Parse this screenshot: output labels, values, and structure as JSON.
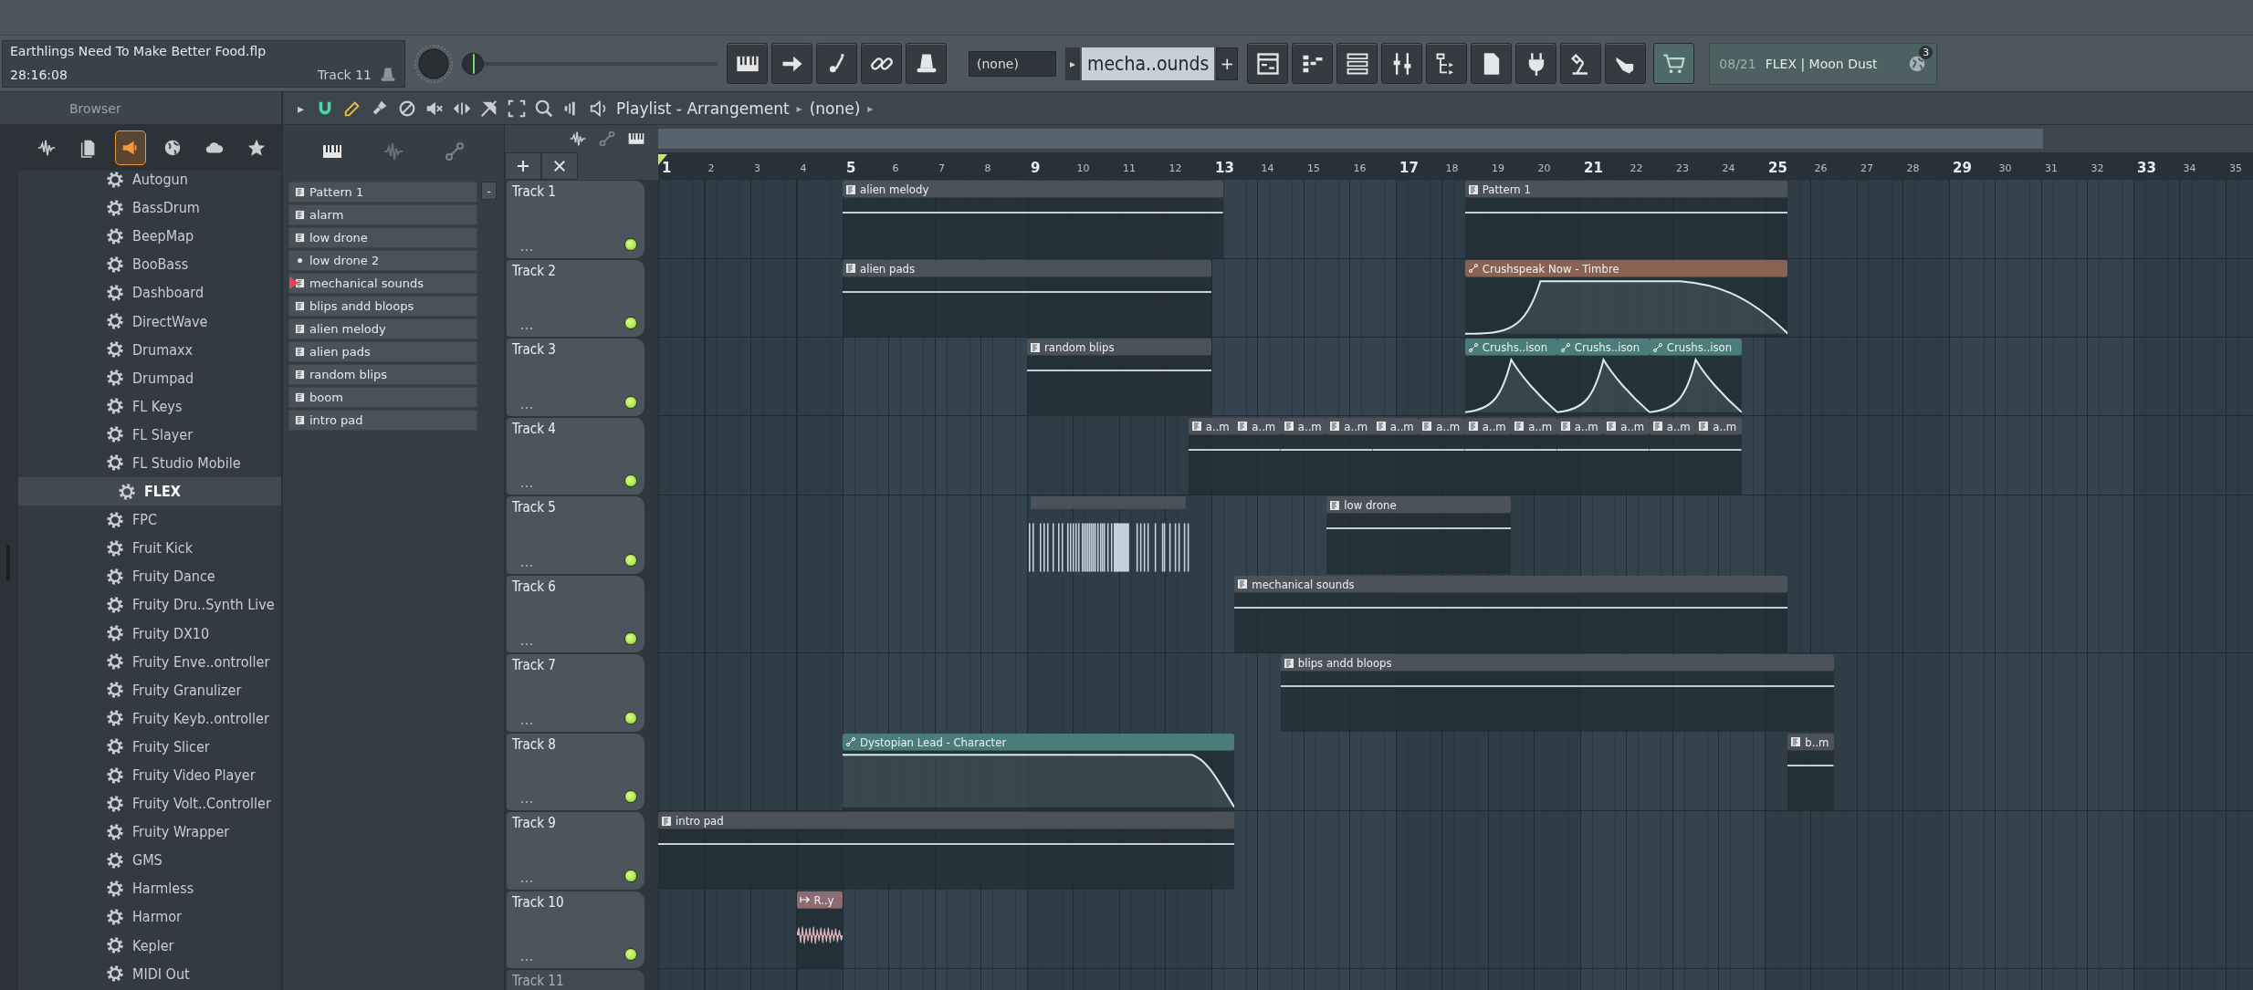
{
  "toolbar": {
    "song_title": "Earthlings Need To Make Better Food.flp",
    "song_time": "28:16:08",
    "hint_target": "Track 11",
    "master_pitch": {
      "level": 0
    },
    "pattern_selector": "(none)",
    "pattern_menu_arrow": "▸",
    "pattern_name": "mecha..ounds",
    "add_pattern": "+",
    "hint_counter": "08/21",
    "hint_text": "FLEX | Moon Dust",
    "notification_count": "3"
  },
  "browser": {
    "title": "Browser",
    "tabs": [
      {
        "kind": "audio",
        "selected": false
      },
      {
        "kind": "files",
        "selected": false
      },
      {
        "kind": "plugins",
        "selected": true
      },
      {
        "kind": "web",
        "selected": false
      },
      {
        "kind": "cloud",
        "selected": false
      },
      {
        "kind": "favorites",
        "selected": false
      }
    ],
    "items": [
      {
        "label": "Autogun",
        "selected": false
      },
      {
        "label": "BassDrum",
        "selected": false
      },
      {
        "label": "BeepMap",
        "selected": false
      },
      {
        "label": "BooBass",
        "selected": false
      },
      {
        "label": "Dashboard",
        "selected": false
      },
      {
        "label": "DirectWave",
        "selected": false
      },
      {
        "label": "Drumaxx",
        "selected": false
      },
      {
        "label": "Drumpad",
        "selected": false
      },
      {
        "label": "FL Keys",
        "selected": false
      },
      {
        "label": "FL Slayer",
        "selected": false
      },
      {
        "label": "FL Studio Mobile",
        "selected": false
      },
      {
        "label": "FLEX",
        "selected": true
      },
      {
        "label": "FPC",
        "selected": false
      },
      {
        "label": "Fruit Kick",
        "selected": false
      },
      {
        "label": "Fruity Dance",
        "selected": false
      },
      {
        "label": "Fruity Dru..Synth Live",
        "selected": false
      },
      {
        "label": "Fruity DX10",
        "selected": false
      },
      {
        "label": "Fruity Enve..ontroller",
        "selected": false
      },
      {
        "label": "Fruity Granulizer",
        "selected": false
      },
      {
        "label": "Fruity Keyb..ontroller",
        "selected": false
      },
      {
        "label": "Fruity Slicer",
        "selected": false
      },
      {
        "label": "Fruity Video Player",
        "selected": false
      },
      {
        "label": "Fruity Volt..Controller",
        "selected": false
      },
      {
        "label": "Fruity Wrapper",
        "selected": false
      },
      {
        "label": "GMS",
        "selected": false
      },
      {
        "label": "Harmless",
        "selected": false
      },
      {
        "label": "Harmor",
        "selected": false
      },
      {
        "label": "Kepler",
        "selected": false
      },
      {
        "label": "MIDI Out",
        "selected": false
      }
    ]
  },
  "playlist": {
    "menu_arrow": "▸",
    "title": "Playlist - Arrangement",
    "breadcrumb": [
      {
        "separator": "▸"
      },
      {
        "label": "(none)",
        "separator": "▸"
      }
    ],
    "patterns": [
      {
        "label": "Pattern 1",
        "kind": "pattern",
        "selected": false
      },
      {
        "label": "alarm",
        "kind": "pattern",
        "selected": false
      },
      {
        "label": "low drone",
        "kind": "pattern",
        "selected": false
      },
      {
        "label": "low drone 2",
        "kind": "layer",
        "selected": false
      },
      {
        "label": "mechanical sounds",
        "kind": "pattern",
        "selected": true
      },
      {
        "label": "blips andd bloops",
        "kind": "pattern",
        "selected": false
      },
      {
        "label": "alien melody",
        "kind": "pattern",
        "selected": false
      },
      {
        "label": "alien pads",
        "kind": "pattern",
        "selected": false
      },
      {
        "label": "random blips",
        "kind": "pattern",
        "selected": false
      },
      {
        "label": "boom",
        "kind": "pattern",
        "selected": false
      },
      {
        "label": "intro pad",
        "kind": "pattern",
        "selected": false
      }
    ],
    "collapse_button": "-",
    "ruler": [
      "1",
      "2",
      "3",
      "4",
      "5",
      "6",
      "7",
      "8",
      "9",
      "10",
      "11",
      "12",
      "13",
      "14",
      "15",
      "16",
      "17",
      "18",
      "19",
      "20",
      "21",
      "22",
      "23",
      "24",
      "25",
      "26",
      "27",
      "28",
      "29",
      "30",
      "31",
      "32",
      "33",
      "34",
      "35"
    ],
    "tracks": [
      {
        "name": "Track 1",
        "dimmed": false,
        "clips": [
          {
            "label": "alien melody",
            "kind": "pattern",
            "color": "#4b5259"
          },
          {
            "label": "Pattern 1",
            "kind": "pattern",
            "color": "#4b5259"
          }
        ]
      },
      {
        "name": "Track 2",
        "dimmed": false,
        "clips": [
          {
            "label": "alien pads",
            "kind": "pattern",
            "color": "#4b5259"
          },
          {
            "label": "Crushspeak Now - Timbre",
            "kind": "ramp",
            "color": "#8a6252"
          }
        ]
      },
      {
        "name": "Track 3",
        "dimmed": false,
        "clips": [
          {
            "label": "random blips",
            "kind": "pattern",
            "color": "#4b5259"
          },
          {
            "label": "Crushs..ison",
            "kind": "peak",
            "color": "#4a7c79"
          },
          {
            "label": "Crushs..ison",
            "kind": "peak",
            "color": "#4a7c79"
          },
          {
            "label": "Crushs..ison",
            "kind": "peak",
            "color": "#4a7c79"
          }
        ]
      },
      {
        "name": "Track 4",
        "dimmed": false,
        "clips": [
          {
            "label": "a..m",
            "kind": "pattern",
            "color": "#4b5259"
          },
          {
            "label": "a..m",
            "kind": "pattern",
            "color": "#4b5259"
          },
          {
            "label": "a..m",
            "kind": "pattern",
            "color": "#4b5259"
          },
          {
            "label": "a..m",
            "kind": "pattern",
            "color": "#4b5259"
          },
          {
            "label": "a..m",
            "kind": "pattern",
            "color": "#4b5259"
          },
          {
            "label": "a..m",
            "kind": "pattern",
            "color": "#4b5259"
          },
          {
            "label": "a..m",
            "kind": "pattern",
            "color": "#4b5259"
          },
          {
            "label": "a..m",
            "kind": "pattern",
            "color": "#4b5259"
          },
          {
            "label": "a..m",
            "kind": "pattern",
            "color": "#4b5259"
          },
          {
            "label": "a..m",
            "kind": "pattern",
            "color": "#4b5259"
          },
          {
            "label": "a..m",
            "kind": "pattern",
            "color": "#4b5259"
          },
          {
            "label": "a..m",
            "kind": "pattern",
            "color": "#4b5259"
          }
        ]
      },
      {
        "name": "Track 5",
        "dimmed": false,
        "clips": [
          {
            "kind": "slices"
          },
          {
            "label": "low drone",
            "kind": "pattern",
            "color": "#4b5259"
          }
        ]
      },
      {
        "name": "Track 6",
        "dimmed": false,
        "clips": [
          {
            "label": "mechanical sounds",
            "kind": "pattern",
            "color": "#4b5259"
          }
        ]
      },
      {
        "name": "Track 7",
        "dimmed": false,
        "clips": [
          {
            "label": "blips andd bloops",
            "kind": "pattern",
            "color": "#4b5259"
          }
        ]
      },
      {
        "name": "Track 8",
        "dimmed": false,
        "clips": [
          {
            "label": "Dystopian Lead - Character",
            "kind": "drop",
            "color": "#4a7c79"
          },
          {
            "label": "b..m",
            "kind": "pattern",
            "color": "#4b5259"
          }
        ]
      },
      {
        "name": "Track 9",
        "dimmed": false,
        "clips": [
          {
            "label": "intro pad",
            "kind": "pattern",
            "color": "#4b5259"
          }
        ]
      },
      {
        "name": "Track 10",
        "dimmed": false,
        "clips": [
          {
            "label": "R..y",
            "kind": "audio",
            "color": "#8e6b70"
          }
        ]
      },
      {
        "name": "Track 11",
        "dimmed": true
      }
    ]
  }
}
